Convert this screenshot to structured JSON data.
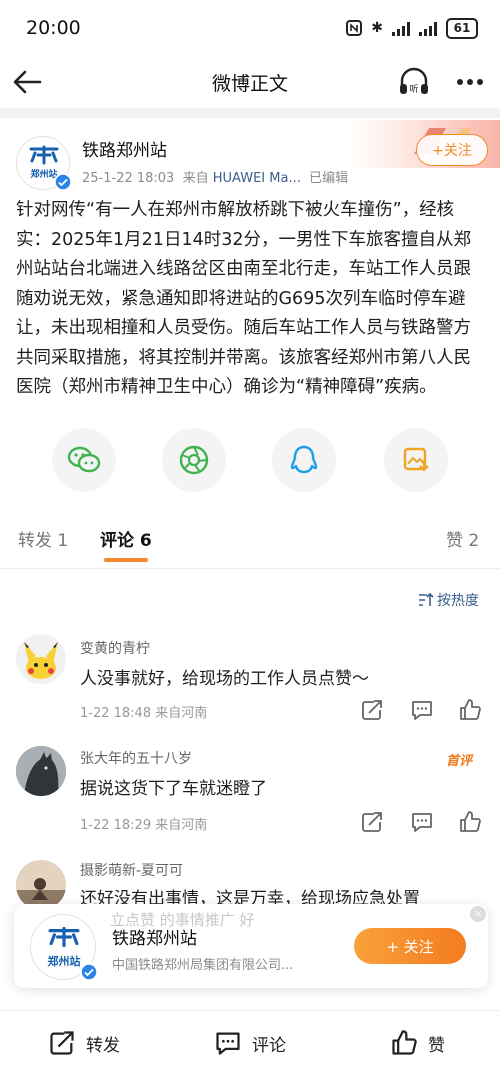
{
  "status_bar": {
    "time": "20:00",
    "bt": "✱",
    "battery": "61"
  },
  "nav": {
    "title": "微博正文",
    "listen_label": "听"
  },
  "post": {
    "author": "铁路郑州站",
    "logo_text": "郑州站",
    "date": "25-1-22 18:03",
    "source_prefix": "来自",
    "source": "HUAWEI Ma...",
    "edited": "已编辑",
    "follow_label": "+关注",
    "body": "针对网传“有一人在郑州市解放桥跳下被火车撞伤”，经核实：2025年1月21日14时32分，一男性下车旅客擅自从郑州站站台北端进入线路岔区由南至北行走，车站工作人员跟随劝说无效，紧急通知即将进站的G695次列车临时停车避让，未出现相撞和人员受伤。随后车站工作人员与铁路警方共同采取措施，将其控制并带离。该旅客经郑州市第八人民医院（郑州市精神卫生中心）确诊为“精神障碍”疾病。"
  },
  "share_icons": [
    "wechat-icon",
    "moments-icon",
    "qq-icon",
    "save-image-icon"
  ],
  "tabs": [
    {
      "label": "转发 1"
    },
    {
      "label": "评论 6"
    },
    {
      "label": "赞 2"
    }
  ],
  "sort_label": "按热度",
  "comments": [
    {
      "name": "变黄的青柠",
      "text": "人没事就好，给现场的工作人员点赞～",
      "meta": "1-22 18:48  来自河南",
      "badge": ""
    },
    {
      "name": "张大年的五十八岁",
      "text": "据说这货下了车就迷瞪了",
      "meta": "1-22 18:29  来自河南",
      "badge": "首评"
    },
    {
      "name": "摄影萌新-夏可可",
      "text": "还好没有出事情，这是万幸，给现场应急处置",
      "meta": "",
      "badge": ""
    }
  ],
  "popup": {
    "ghost_text": "立点赞     的事情推广     好",
    "close": "×",
    "name": "铁路郑州站",
    "subtitle": "中国铁路郑州局集团有限公司...",
    "follow_label": "+ 关注"
  },
  "bottom_bar": {
    "repost": "转发",
    "comment": "评论",
    "like": "赞"
  },
  "colors": {
    "accent": "#f28b2b",
    "link": "#3a5f8f",
    "brand_blue": "#1660b0"
  }
}
